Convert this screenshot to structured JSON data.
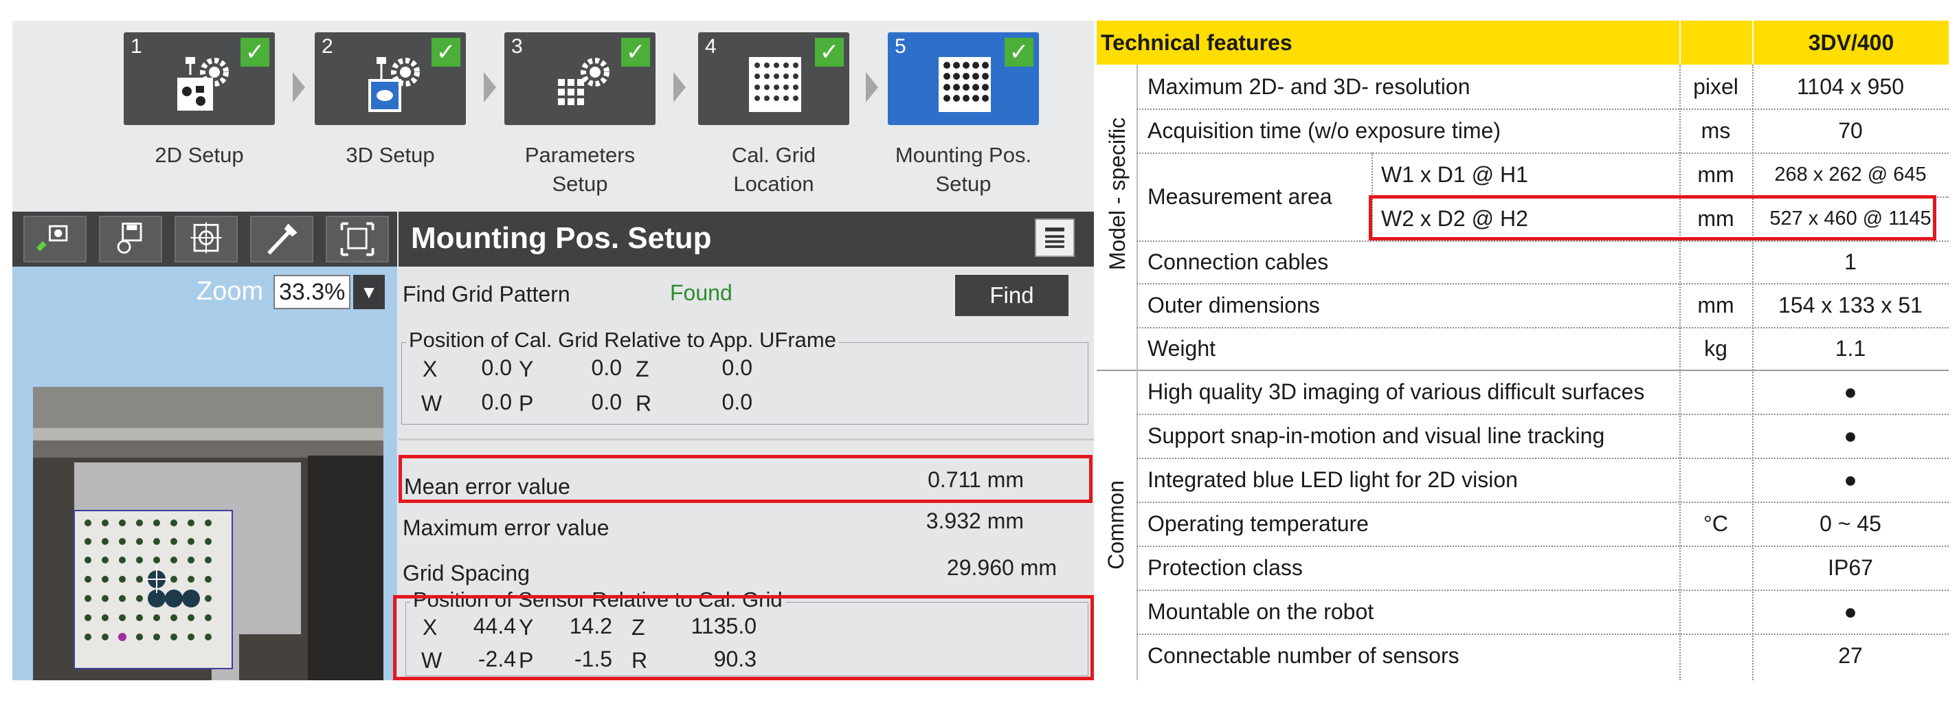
{
  "steps": [
    {
      "num": "1",
      "label_l1": "2D Setup",
      "label_l2": "",
      "icon": "camera-gear-icon",
      "checked": true
    },
    {
      "num": "2",
      "label_l1": "3D Setup",
      "label_l2": "",
      "icon": "camera-gear-3d-icon",
      "checked": true
    },
    {
      "num": "3",
      "label_l1": "Parameters",
      "label_l2": "Setup",
      "icon": "grid-gear-icon",
      "checked": true
    },
    {
      "num": "4",
      "label_l1": "Cal. Grid",
      "label_l2": "Location",
      "icon": "dot-grid-icon",
      "checked": true
    },
    {
      "num": "5",
      "label_l1": "Mounting Pos.",
      "label_l2": "Setup",
      "icon": "dot-grid-large-icon",
      "checked": true
    }
  ],
  "toolbar_icons": [
    "camera-snap-icon",
    "save-image-icon",
    "target-icon",
    "wand-icon",
    "fit-view-icon"
  ],
  "zoom": {
    "label": "Zoom",
    "value": "33.3%"
  },
  "main": {
    "title": "Mounting Pos. Setup",
    "find_label": "Find Grid Pattern",
    "find_status": "Found",
    "find_button": "Find",
    "grid_group": {
      "title": "Position of Cal. Grid Relative to App. UFrame",
      "X": "0.0",
      "Y": "0.0",
      "Z": "0.0",
      "W": "0.0",
      "P": "0.0",
      "R": "0.0"
    },
    "mean_error_label": "Mean error value",
    "mean_error_value": "0.711 mm",
    "max_error_label": "Maximum error value",
    "max_error_value": "3.932 mm",
    "grid_spacing_label": "Grid Spacing",
    "grid_spacing_value": "29.960 mm",
    "sensor_group": {
      "title": "Position of Sensor Relative to Cal. Grid",
      "X": "44.4",
      "Y": "14.2",
      "Z": "1135.0",
      "W": "-2.4",
      "P": "-1.5",
      "R": "90.3"
    },
    "axis_labels": {
      "X": "X",
      "Y": "Y",
      "Z": "Z",
      "W": "W",
      "P": "P",
      "R": "R"
    }
  },
  "spec": {
    "header_feature": "Technical features",
    "header_model": "3DV/400",
    "group_model": "Model - specific",
    "group_common": "Common",
    "rows": [
      {
        "feature": "Maximum 2D- and 3D- resolution",
        "unit": "pixel",
        "value": "1104 x 950"
      },
      {
        "feature": "Acquisition time (w/o exposure time)",
        "unit": "ms",
        "value": "70"
      },
      {
        "feature": "Measurement area",
        "sub1": "W1 x D1 @ H1",
        "unit1": "mm",
        "value1": "268 x 262 @ 645",
        "sub2": "W2 x D2 @ H2",
        "unit2": "mm",
        "value2": "527 x 460 @ 1145"
      },
      {
        "feature": "Connection cables",
        "unit": "",
        "value": "1"
      },
      {
        "feature": "Outer dimensions",
        "unit": "mm",
        "value": "154 x 133 x 51"
      },
      {
        "feature": "Weight",
        "unit": "kg",
        "value": "1.1"
      },
      {
        "feature": "High quality 3D imaging of various difficult surfaces",
        "unit": "",
        "value": "●"
      },
      {
        "feature": "Support snap-in-motion and visual line tracking",
        "unit": "",
        "value": "●"
      },
      {
        "feature": "Integrated blue LED light for 2D vision",
        "unit": "",
        "value": "●"
      },
      {
        "feature": "Operating temperature",
        "unit": "°C",
        "value": "0 ~ 45"
      },
      {
        "feature": "Protection class",
        "unit": "",
        "value": "IP67"
      },
      {
        "feature": "Mountable on the robot",
        "unit": "",
        "value": "●"
      },
      {
        "feature": "Connectable number of sensors",
        "unit": "",
        "value": "27"
      }
    ]
  },
  "colors": {
    "highlight": "#e3181d",
    "spec_header": "#ffdd00",
    "found_text": "#2e8b2e",
    "active_step": "#2e6fc9"
  }
}
